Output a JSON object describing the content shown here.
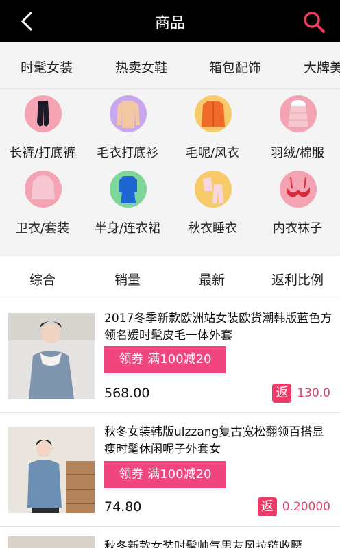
{
  "header": {
    "title": "商品",
    "back_icon": "chevron-left-icon",
    "search_icon": "search-icon",
    "accent": "#ee3a5e"
  },
  "category_tabs": [
    "时髦女装",
    "热卖女鞋",
    "箱包配饰",
    "大牌美"
  ],
  "subcategories": [
    {
      "label": "长裤/打底裤",
      "icon": "leggings-icon",
      "bg": "#f4a3b3"
    },
    {
      "label": "毛衣打底衫",
      "icon": "sweater-icon",
      "bg": "#c7a8ee"
    },
    {
      "label": "毛呢/风衣",
      "icon": "coat-icon",
      "bg": "#f8cb6a"
    },
    {
      "label": "羽绒/棉服",
      "icon": "down-jacket-icon",
      "bg": "#f4a3b3"
    },
    {
      "label": "卫衣/套装",
      "icon": "hoodie-icon",
      "bg": "#f4a3b3"
    },
    {
      "label": "半身/连衣裙",
      "icon": "dress-icon",
      "bg": "#7fd69a"
    },
    {
      "label": "秋衣睡衣",
      "icon": "pajamas-icon",
      "bg": "#f8cb6a"
    },
    {
      "label": "内衣袜子",
      "icon": "bra-icon",
      "bg": "#f4a3b3"
    }
  ],
  "sort_options": [
    "综合",
    "销量",
    "最新",
    "返利比例"
  ],
  "products": [
    {
      "title": "2017冬季新款欧洲站女装欧货潮韩版蓝色方领名媛时髦皮毛一体外套",
      "coupon": "领券 满100减20",
      "price": "568.00",
      "rebate_tag": "返",
      "rebate": "130.0"
    },
    {
      "title": "秋冬女装韩版ulzzang复古宽松翻领百搭显瘦时髦休闲呢子外套女",
      "coupon": "领券 满100减20",
      "price": "74.80",
      "rebate_tag": "返",
      "rebate": "0.20000"
    },
    {
      "title": "秋冬新款女装时髦帅气男友风拉链收腰"
    }
  ]
}
